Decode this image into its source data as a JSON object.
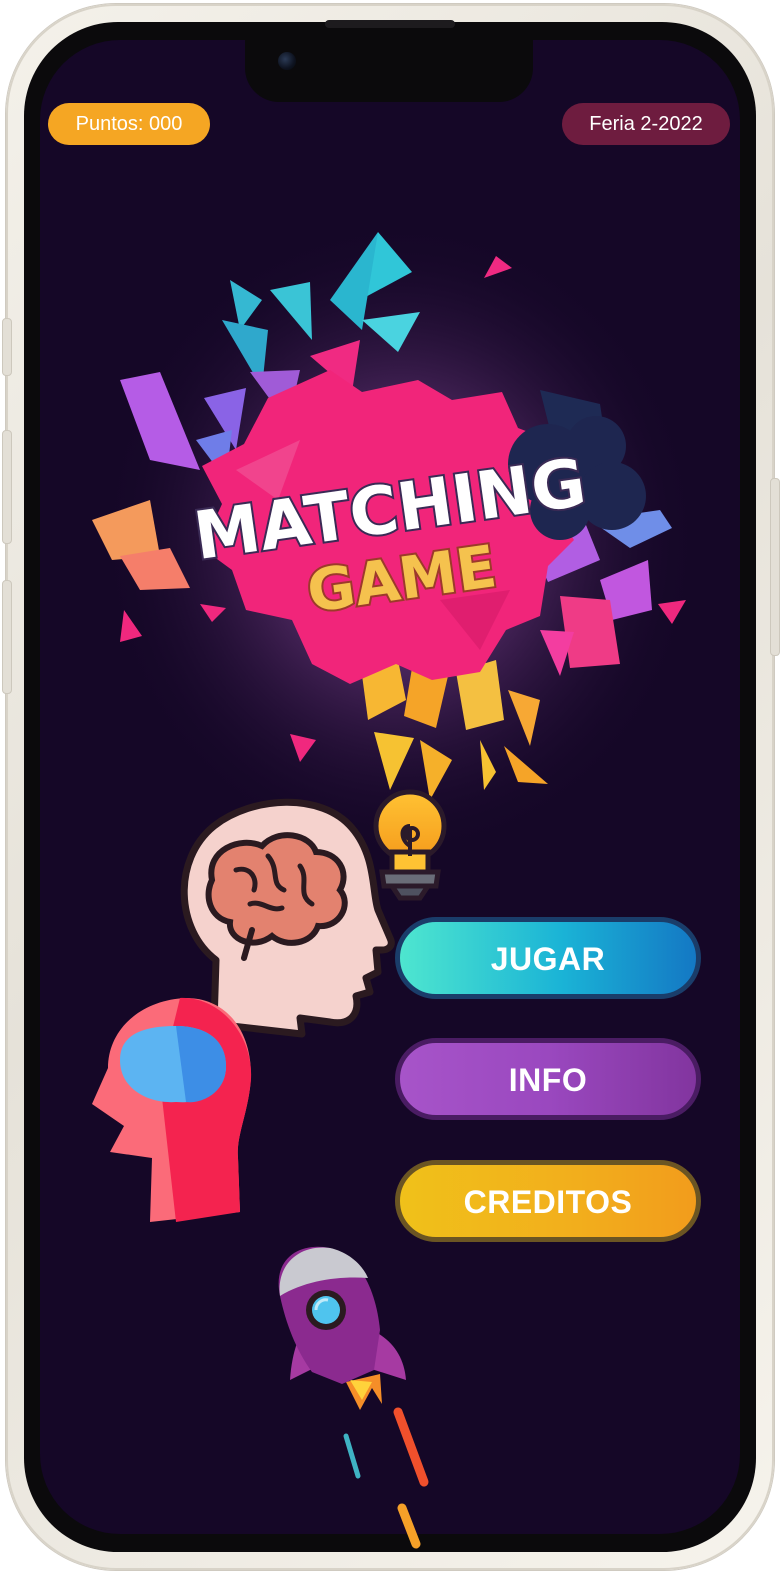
{
  "hud": {
    "score_label": "Puntos: 000",
    "event_label": "Feria 2-2022"
  },
  "logo": {
    "line1": "MATCHING",
    "line2": "GAME"
  },
  "menu": {
    "play_label": "JUGAR",
    "info_label": "INFO",
    "credits_label": "CREDITOS"
  },
  "icons": [
    "brain-head-icon",
    "lightbulb-icon",
    "red-head-icon",
    "rocket-icon"
  ],
  "colors": {
    "background": "#150727",
    "score_pill": "#f5a623",
    "event_pill": "#6e1c3f",
    "logo_splash": "#f1257a",
    "logo_secondary": "#f5c24e"
  }
}
